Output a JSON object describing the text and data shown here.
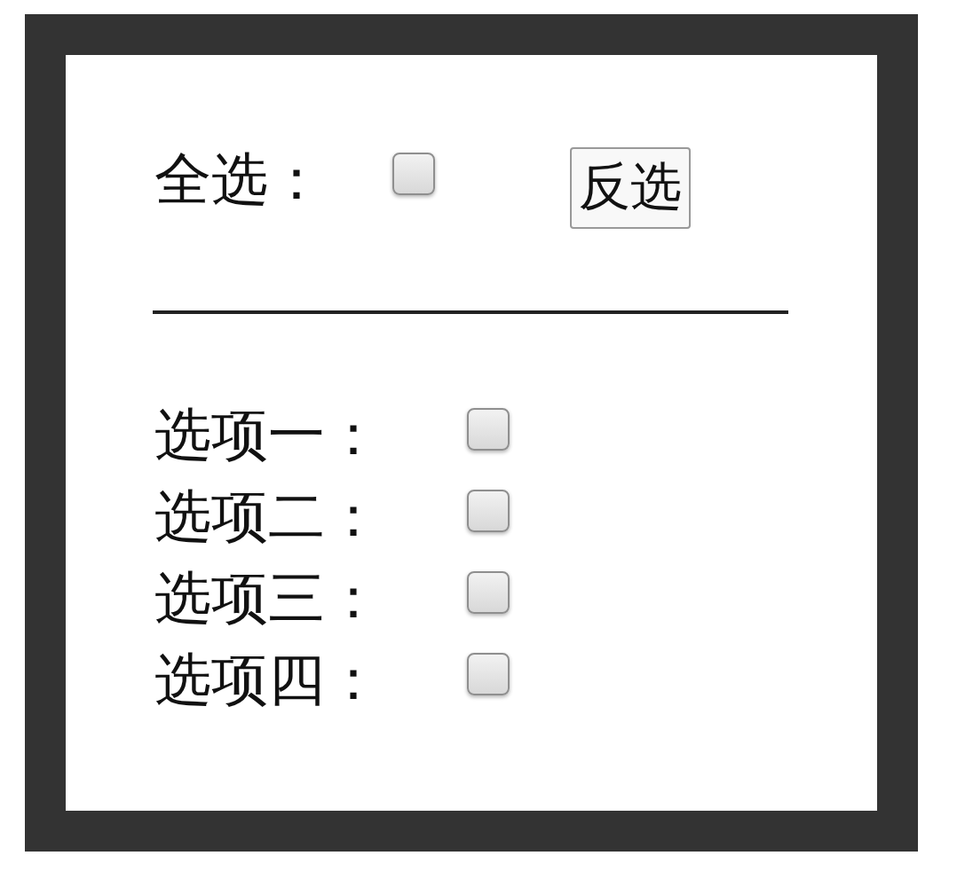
{
  "select_all": {
    "label": "全选：",
    "checked": false
  },
  "invert_button": {
    "label": "反选"
  },
  "options": [
    {
      "label": "选项一：",
      "checked": false
    },
    {
      "label": "选项二：",
      "checked": false
    },
    {
      "label": "选项三：",
      "checked": false
    },
    {
      "label": "选项四：",
      "checked": false
    }
  ]
}
